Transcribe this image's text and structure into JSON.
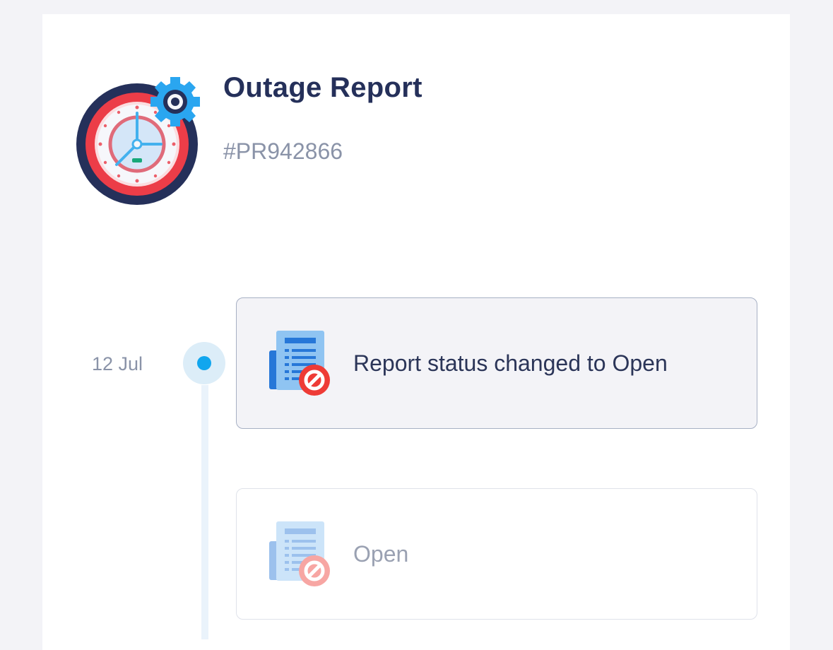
{
  "header": {
    "title": "Outage Report",
    "report_id": "#PR942866",
    "icon": "clock-gear-icon"
  },
  "timeline": {
    "date": "12 Jul",
    "events": [
      {
        "text": "Report status changed to Open",
        "icon": "document-blocked-icon",
        "active": true
      },
      {
        "text": "Open",
        "icon": "document-blocked-icon",
        "active": false
      }
    ]
  },
  "colors": {
    "background": "#f3f3f7",
    "title": "#25305a",
    "muted": "#8a93a8",
    "accent": "#11a6ee",
    "blocked": "#ee3b36"
  }
}
